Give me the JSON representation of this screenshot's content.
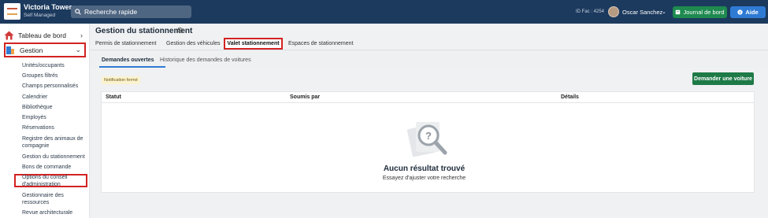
{
  "header": {
    "org_name": "Victoria Towers",
    "org_type": "Self Managed",
    "search_placeholder": "Recherche rapide",
    "id_fac": "ID Fac : 4254",
    "user_name": "Oscar Sanchez",
    "journal_label": "Journal de bord",
    "aide_label": "Aide"
  },
  "sidebar": {
    "dashboard_label": "Tableau de bord",
    "gestion_label": "Gestion",
    "items": [
      "Unités/occupants",
      "Groupes filtrés",
      "Champs personnalisés",
      "Calendrier",
      "Bibliothèque",
      "Employés",
      "Réservations",
      "Registre des animaux de compagnie",
      "Gestion du stationnement",
      "Bons de commande",
      "Options du conseil d'administration",
      "Gestionnaire des ressources",
      "Revue architecturale"
    ]
  },
  "page": {
    "title": "Gestion du stationnement",
    "tabs": [
      "Permis de stationnement",
      "Gestion des véhicules",
      "Valet stationnement",
      "Espaces de stationnement"
    ],
    "subtabs": [
      "Demandes ouvertes",
      "Historique des demandes de voitures"
    ],
    "notification": "Notification fermé",
    "request_button": "Demander une voiture",
    "table": {
      "columns": [
        "Statut",
        "Soumis par",
        "Détails"
      ]
    },
    "empty_title": "Aucun résultat trouvé",
    "empty_subtitle": "Essayez d'ajuster votre recherche"
  },
  "colors": {
    "topbar": "#1c3a5e",
    "green_button": "#1e8a4f",
    "blue_button": "#2f7bd4",
    "highlight": "#d32222"
  }
}
